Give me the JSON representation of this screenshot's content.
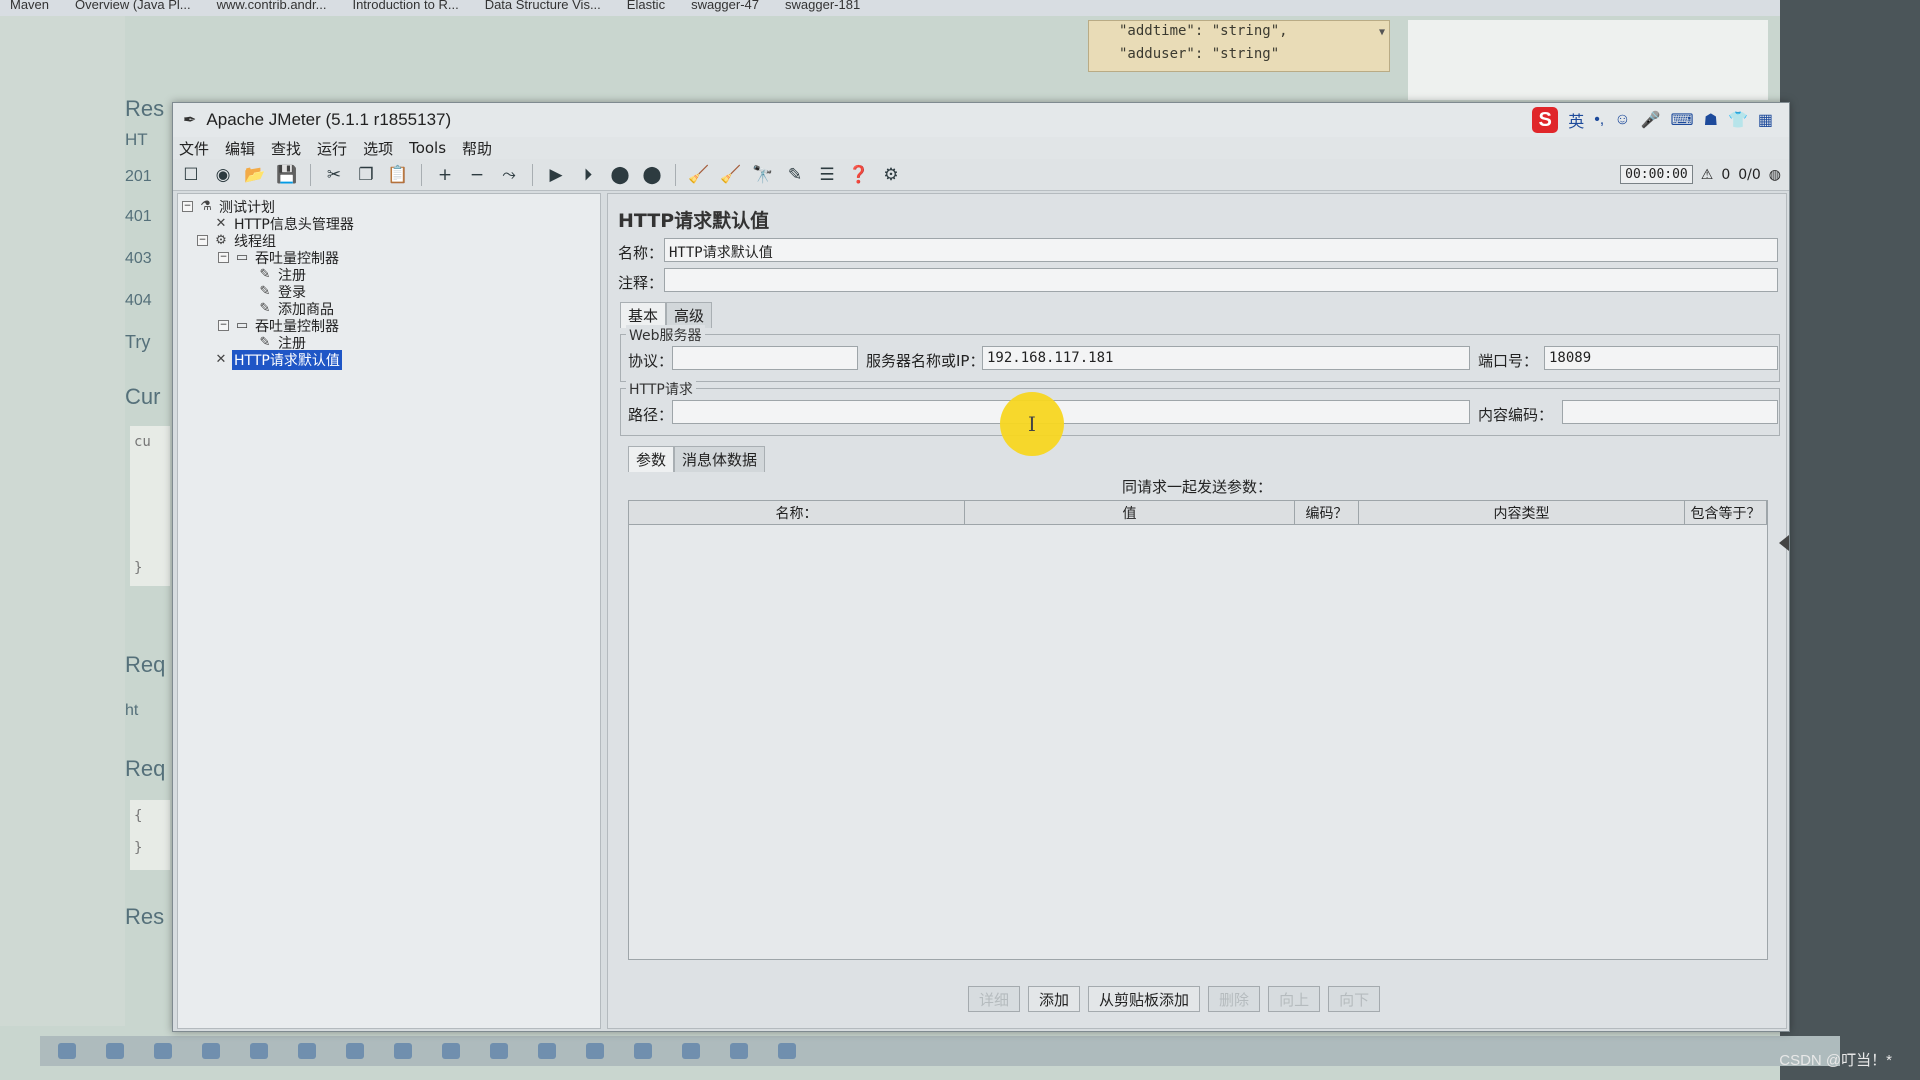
{
  "browser": {
    "bookmarks": [
      "Maven",
      "Overview (Java Pl...",
      "www.contrib.andr...",
      "Introduction to R...",
      "Data Structure Vis...",
      "Elastic",
      "swagger-47",
      "swagger-181"
    ],
    "json_snippet": [
      "\"addtime\": \"string\",",
      "\"adduser\": \"string\""
    ],
    "side_texts": [
      "Res",
      "HT",
      "201",
      "401",
      "403",
      "404",
      "Try",
      "Cur",
      "Req",
      "ht",
      "Req",
      "Res"
    ],
    "code_side": [
      "cu",
      "}",
      "{",
      "}"
    ]
  },
  "window": {
    "title": "Apache JMeter (5.1.1 r1855137)",
    "ime_label": "英"
  },
  "menu": [
    "文件",
    "编辑",
    "查找",
    "运行",
    "选项",
    "Tools",
    "帮助"
  ],
  "toolbar": {
    "timer": "00:00:00",
    "warning_count": "0",
    "threads": "0/0"
  },
  "tree": [
    {
      "label": "测试计划",
      "indent": 0,
      "icon": "flask-icon",
      "expander": "⊟"
    },
    {
      "label": "HTTP信息头管理器",
      "indent": 1,
      "icon": "wrench-icon",
      "expander": ""
    },
    {
      "label": "线程组",
      "indent": 1,
      "icon": "gear-icon",
      "expander": "⊟"
    },
    {
      "label": "吞吐量控制器",
      "indent": 2,
      "icon": "controller-icon",
      "expander": "⊟"
    },
    {
      "label": "注册",
      "indent": 3,
      "icon": "pencil-icon",
      "expander": ""
    },
    {
      "label": "登录",
      "indent": 3,
      "icon": "pencil-icon",
      "expander": ""
    },
    {
      "label": "添加商品",
      "indent": 3,
      "icon": "pencil-icon",
      "expander": ""
    },
    {
      "label": "吞吐量控制器",
      "indent": 2,
      "icon": "controller-icon",
      "expander": "⊟"
    },
    {
      "label": "注册",
      "indent": 3,
      "icon": "pencil-icon",
      "expander": ""
    },
    {
      "label": "HTTP请求默认值",
      "indent": 1,
      "icon": "wrench-icon",
      "expander": "",
      "selected": true
    }
  ],
  "panel": {
    "title": "HTTP请求默认值",
    "name_label": "名称：",
    "name_value": "HTTP请求默认值",
    "comment_label": "注释：",
    "comment_value": "",
    "tabs": [
      "基本",
      "高级"
    ],
    "web_server_group": "Web服务器",
    "protocol_label": "协议：",
    "protocol_value": "",
    "server_label": "服务器名称或IP：",
    "server_value": "192.168.117.181",
    "port_label": "端口号：",
    "port_value": "18089",
    "http_request_group": "HTTP请求",
    "path_label": "路径：",
    "path_value": "",
    "encoding_label": "内容编码：",
    "encoding_value": "",
    "sub_tabs": [
      "参数",
      "消息体数据"
    ],
    "params_caption": "同请求一起发送参数：",
    "columns": [
      "名称：",
      "值",
      "编码？",
      "内容类型",
      "包含等于？"
    ],
    "buttons": [
      {
        "label": "详细",
        "enabled": false
      },
      {
        "label": "添加",
        "enabled": true
      },
      {
        "label": "从剪贴板添加",
        "enabled": true
      },
      {
        "label": "删除",
        "enabled": false
      },
      {
        "label": "向上",
        "enabled": false
      },
      {
        "label": "向下",
        "enabled": false
      }
    ]
  },
  "watermark": "CSDN @叮当！*"
}
